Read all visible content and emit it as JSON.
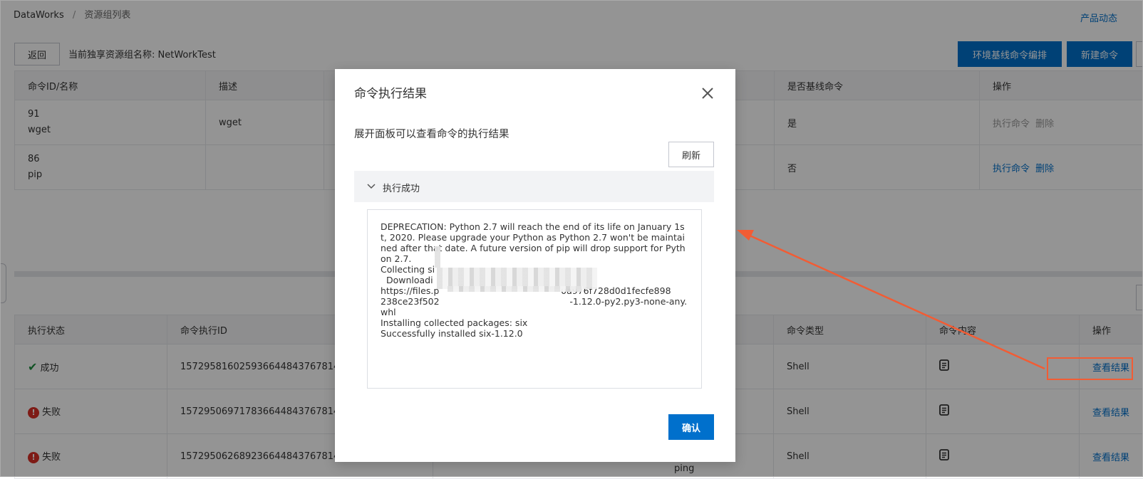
{
  "breadcrumb": {
    "root": "DataWorks",
    "sep": "/",
    "current": "资源组列表"
  },
  "header": {
    "product_news": "产品动态"
  },
  "toolbar": {
    "back": "返回",
    "group_label": "当前独享资源组名称: NetWorkTest",
    "env_baseline": "环境基线命令编排",
    "new_command": "新建命令"
  },
  "commands_table": {
    "headers": [
      "命令ID/名称",
      "描述",
      "",
      "是否基线命令",
      "操作"
    ],
    "rows": [
      {
        "id": "91",
        "name": "wget",
        "desc": "wget",
        "baseline": "是",
        "action_run": "执行命令",
        "action_delete": "删除",
        "disabled": true
      },
      {
        "id": "86",
        "name": "pip",
        "desc": "",
        "baseline": "否",
        "action_run": "执行命令",
        "action_delete": "删除",
        "disabled": false
      }
    ]
  },
  "exec_table": {
    "headers": [
      "执行状态",
      "命令执行ID",
      "",
      "命令类型",
      "命令内容",
      "操作"
    ],
    "rows": [
      {
        "status": "成功",
        "status_type": "success",
        "exec_id": "1572958160259366448437678145",
        "extra": "",
        "type": "Shell",
        "action": "查看结果"
      },
      {
        "status": "失败",
        "status_type": "error",
        "exec_id": "1572950697178366448437678145",
        "extra": "",
        "type": "Shell",
        "action": "查看结果"
      },
      {
        "status": "失败",
        "status_type": "error",
        "exec_id": "1572950626892366448437678145",
        "extra": "ping",
        "type": "Shell",
        "action": "查看结果"
      }
    ]
  },
  "modal": {
    "title": "命令执行结果",
    "hint": "展开面板可以查看命令的执行结果",
    "refresh": "刷新",
    "panel_title": "执行成功",
    "log": "DEPRECATION: Python 2.7 will reach the end of its life on January 1st, 2020. Please upgrade your Python as Python 2.7 won't be maintained after that date. A future version of pip will drop support for Python 2.7.\nCollecting si\n  Downloadi\nhttps://files.p                                           0a976f728d0d1fecfe898\n238ce23f502                                              -1.12.0-py2.py3-none-any.whl\nInstalling collected packages: six\nSuccessfully installed six-1.12.0",
    "confirm": "确认"
  },
  "colors": {
    "primary": "#0070cc",
    "annotation": "#f25c34",
    "success": "#1e8e3e",
    "error": "#d93026"
  },
  "icons": {
    "close": "close-icon",
    "chevron": "chevron-down-icon",
    "doc": "document-icon"
  }
}
